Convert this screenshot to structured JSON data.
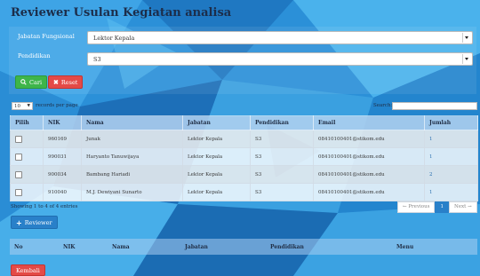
{
  "page": {
    "title": "Reviewer Usulan Kegiatan analisa"
  },
  "filters": {
    "jabatan_label": "Jabatan Fungsional",
    "jabatan_value": "Lektor Kepala",
    "pendidikan_label": "Pendidikan",
    "pendidikan_value": "S3",
    "search_button": "Cari",
    "reset_button": "Reset"
  },
  "table_controls": {
    "page_size": "10",
    "page_size_suffix": "records per page",
    "search_label": "Search:"
  },
  "candidates": {
    "headers": [
      "Pilih",
      "NIK",
      "Nama",
      "Jabatan",
      "Pendidikan",
      "Email",
      "Jumlah"
    ],
    "rows": [
      [
        "",
        "960169",
        "Junak",
        "Lektor Kepala",
        "S3",
        "08410100401@stikom.edu",
        "1"
      ],
      [
        "",
        "990031",
        "Haryanto Tanuwijaya",
        "Lektor Kepala",
        "S3",
        "08410100401@stikom.edu",
        "1"
      ],
      [
        "",
        "900034",
        "Bambang Hariadi",
        "Lektor Kepala",
        "S3",
        "08410100401@stikom.edu",
        "2"
      ],
      [
        "",
        "910040",
        "M.J. Dewiyani Sunarto",
        "Lektor Kepala",
        "S3",
        "08410100401@stikom.edu",
        "1"
      ]
    ],
    "info": "Showing 1 to 4 of 4 entries"
  },
  "pagination": {
    "previous": "← Previous",
    "current": "1",
    "next": "Next →"
  },
  "add_button": "Reviewer",
  "reviewers": {
    "headers": [
      "No",
      "NIK",
      "Nama",
      "Jabatan",
      "Pendidikan",
      "Menu"
    ]
  },
  "back_button": "Kembali",
  "colors": {
    "accent": "#2980c9",
    "success": "#3eb54a",
    "danger": "#e44a47",
    "background": "#2a8fd6"
  },
  "icons": {
    "search": "search-icon",
    "reset": "close-icon",
    "add": "plus-icon"
  }
}
